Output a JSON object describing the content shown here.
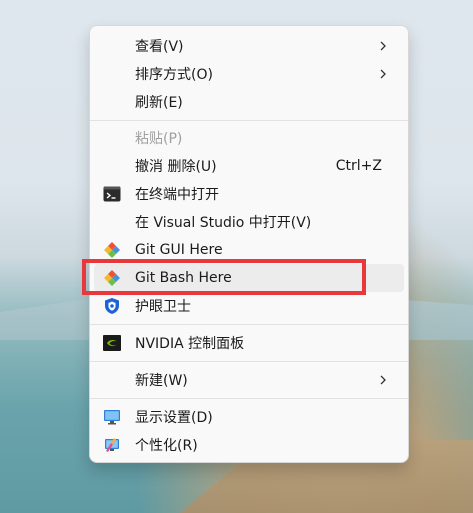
{
  "menu": {
    "view": {
      "label": "查看(V)",
      "icon": "none",
      "submenu": true
    },
    "sort": {
      "label": "排序方式(O)",
      "icon": "none",
      "submenu": true
    },
    "refresh": {
      "label": "刷新(E)",
      "icon": "none"
    },
    "paste": {
      "label": "粘贴(P)",
      "icon": "none",
      "disabled": true
    },
    "undo": {
      "label": "撤消 删除(U)",
      "shortcut": "Ctrl+Z"
    },
    "terminal": {
      "label": "在终端中打开",
      "icon": "terminal-icon"
    },
    "vs": {
      "label": "在 Visual Studio 中打开(V)",
      "icon": "none"
    },
    "git_gui": {
      "label": "Git GUI Here",
      "icon": "git-diamond-icon"
    },
    "git_bash": {
      "label": "Git Bash Here",
      "icon": "git-diamond-icon",
      "hovered": true
    },
    "eye_guard": {
      "label": "护眼卫士",
      "icon": "shield-eye-icon"
    },
    "nvidia": {
      "label": "NVIDIA 控制面板",
      "icon": "nvidia-logo-icon"
    },
    "new": {
      "label": "新建(W)",
      "icon": "none",
      "submenu": true
    },
    "display": {
      "label": "显示设置(D)",
      "icon": "monitor-icon"
    },
    "personalize": {
      "label": "个性化(R)",
      "icon": "brush-monitor-icon"
    }
  },
  "colors": {
    "menu_bg": "#f9f9f9",
    "hover_bg": "#ececec",
    "highlight_box": "#e8383b",
    "disabled_text": "#a0a0a0",
    "git_orange": "#f05133",
    "shield_blue": "#1d63d8",
    "nvidia_green": "#76b900"
  }
}
